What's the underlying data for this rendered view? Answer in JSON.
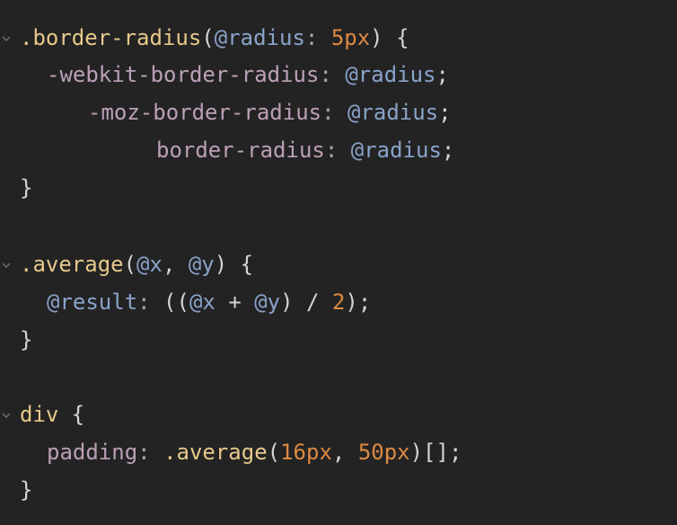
{
  "theme": {
    "background": "#232324",
    "selector": "#e6c98a",
    "variable": "#8aa3c9",
    "number": "#dc8a41",
    "property": "#bca0b6",
    "punctuation": "#d4d4d4"
  },
  "lines": {
    "l1": {
      "sel": ".border-radius",
      "p1": "(",
      "var": "@radius",
      "colon": ":",
      "sp": " ",
      "num": "5px",
      "p2": ")",
      "brace": " {"
    },
    "l2": {
      "prop": "-webkit-border-radius",
      "colon": ":",
      "sp": " ",
      "var": "@radius",
      "semi": ";"
    },
    "l3": {
      "prop": "-moz-border-radius",
      "colon": ":",
      "sp": " ",
      "var": "@radius",
      "semi": ";"
    },
    "l4": {
      "prop": "border-radius",
      "colon": ":",
      "sp": " ",
      "var": "@radius",
      "semi": ";"
    },
    "l5": {
      "brace": "}"
    },
    "l7": {
      "sel": ".average",
      "p1": "(",
      "var1": "@x",
      "comma": ", ",
      "var2": "@y",
      "p2": ")",
      "brace": " {"
    },
    "l8": {
      "var": "@result",
      "colon": ":",
      "mid": " ((",
      "var1": "@x",
      "plus": " + ",
      "var2": "@y",
      "div": ") / ",
      "num": "2",
      "end": ");"
    },
    "l9": {
      "brace": "}"
    },
    "l11": {
      "sel": "div",
      "brace": " {"
    },
    "l12": {
      "prop": "padding",
      "colon": ":",
      "sp": " ",
      "sel": ".average",
      "p1": "(",
      "num1": "16px",
      "comma": ", ",
      "num2": "50px",
      "end": ")[];"
    },
    "l13": {
      "brace": "}"
    }
  }
}
